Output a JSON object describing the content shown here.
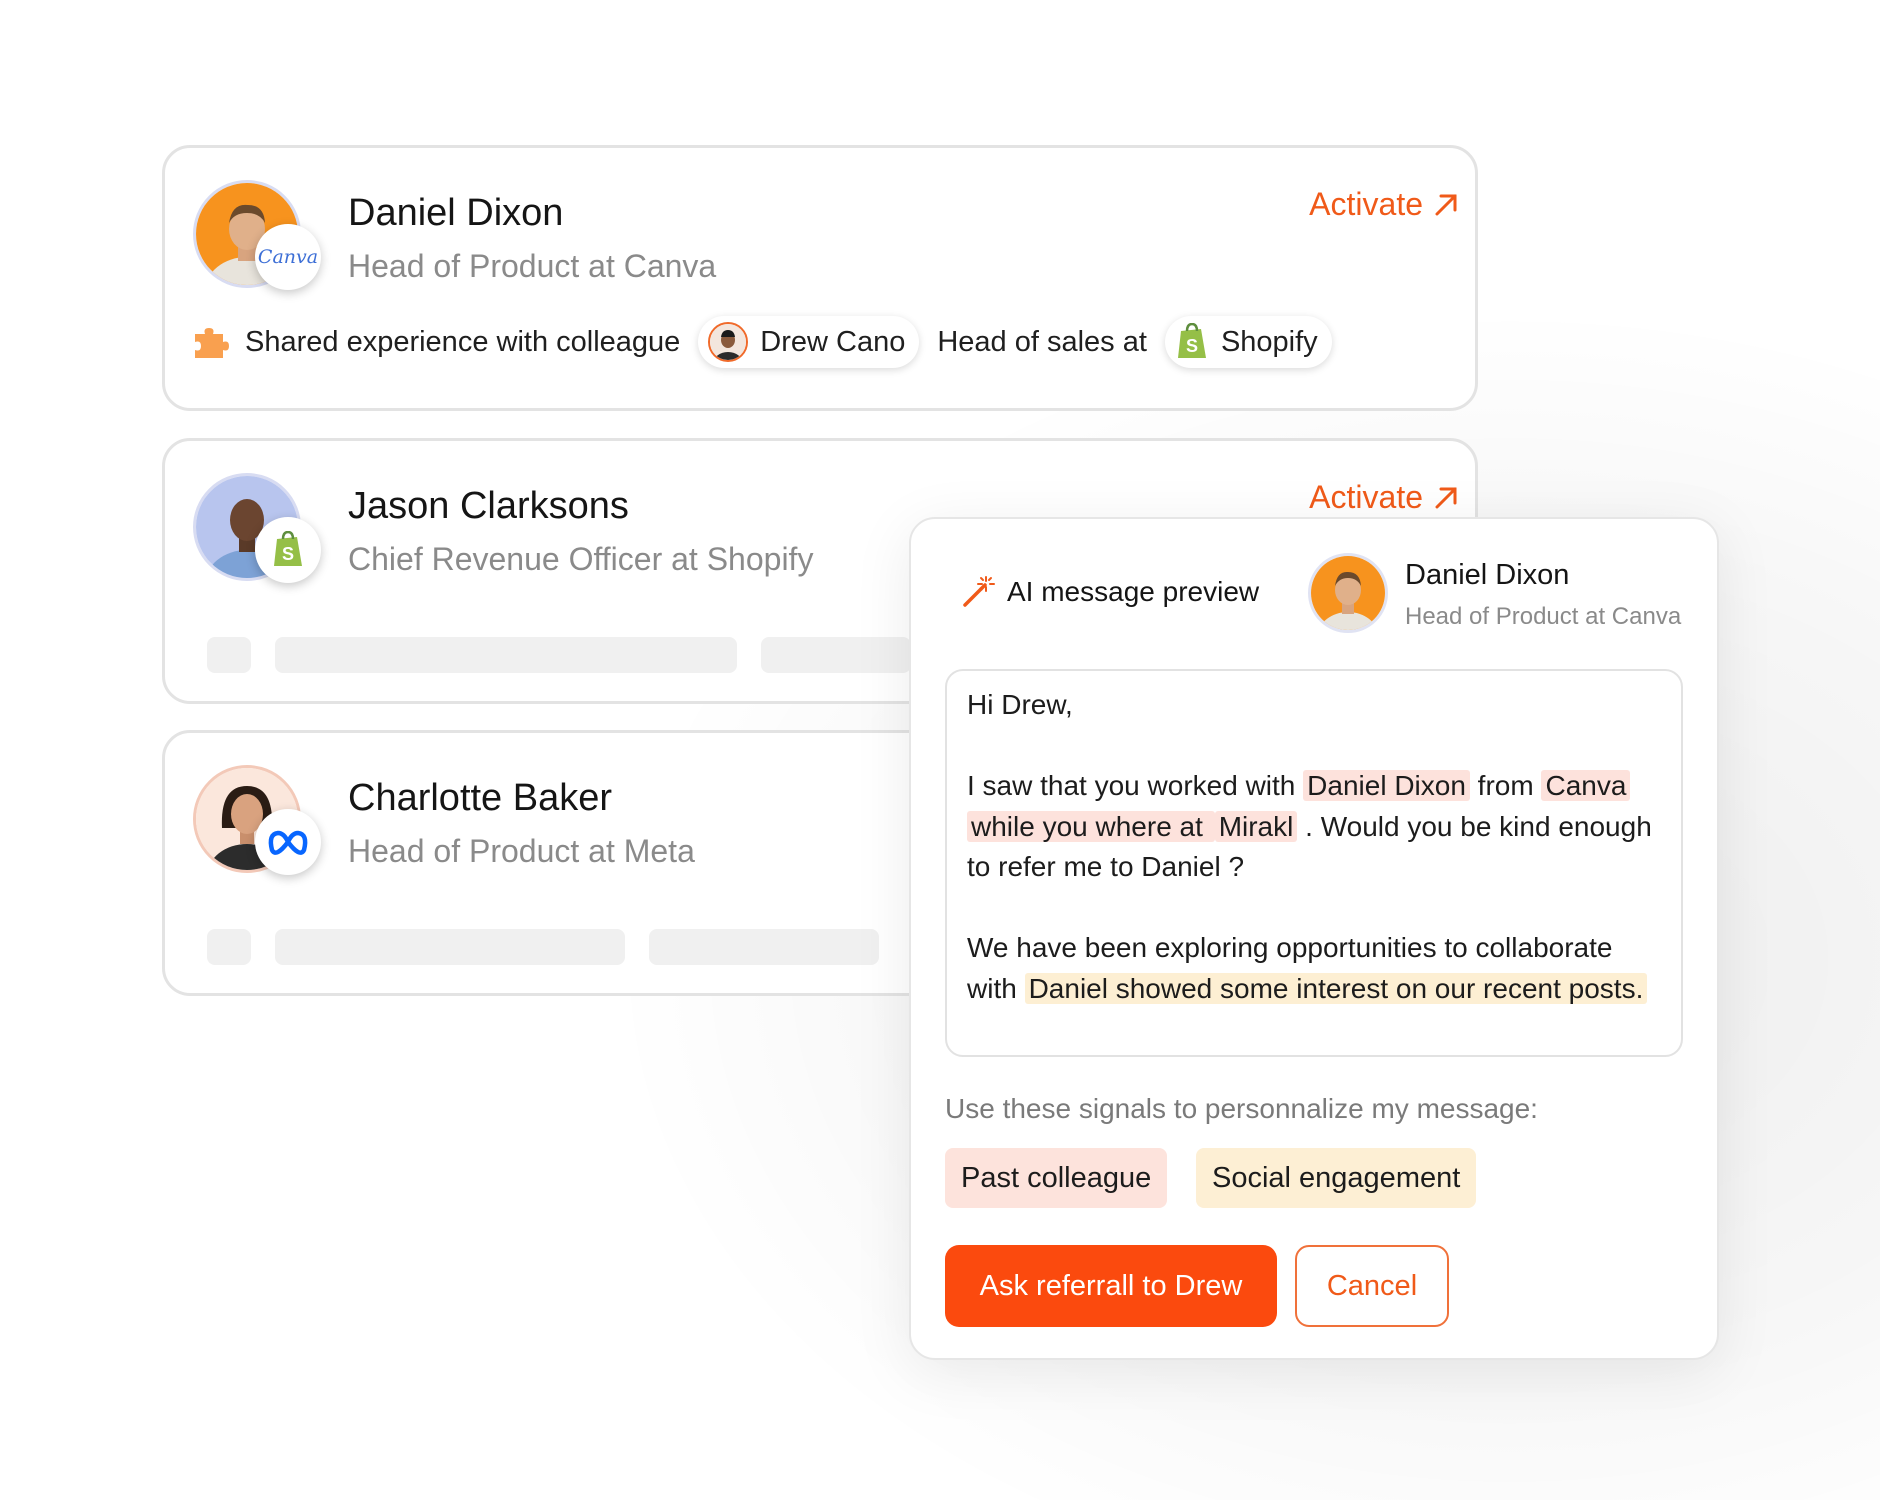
{
  "contacts": [
    {
      "name": "Daniel Dixon",
      "title": "Head of Product at Canva",
      "company_badge": "Canva",
      "activate_label": "Activate",
      "signal": {
        "icon": "puzzle-icon",
        "text": "Shared experience with colleague",
        "colleague_name": "Drew Cano",
        "connector": "Head of sales at",
        "company": "Shopify"
      }
    },
    {
      "name": "Jason Clarksons",
      "title": "Chief Revenue Officer at Shopify",
      "company_badge": "shopify-logo-icon",
      "activate_label": "Activate"
    },
    {
      "name": "Charlotte Baker",
      "title": "Head of Product at Meta",
      "company_badge": "meta-logo-icon"
    }
  ],
  "preview": {
    "label": "AI message preview",
    "contact_name": "Daniel Dixon",
    "contact_title": "Head of Product at Canva",
    "message": {
      "greeting": "Hi Drew,",
      "p1_a": "I saw that you worked with ",
      "p1_hl1": "Daniel Dixon",
      "p1_b": " from ",
      "p1_hl2": "Canva",
      "p1_hl3": "while you where at ",
      "p1_hl4": "Mirakl",
      "p1_c": " . Would you be kind enough to refer me to Daniel ?",
      "p2_a": "We have been exploring opportunities to collaborate with ",
      "p2_hl": "Daniel showed some interest on our recent posts."
    },
    "signals_label": "Use these signals to personnalize my message:",
    "signals": [
      "Past colleague",
      "Social engagement"
    ],
    "primary_button": "Ask referrall to Drew",
    "cancel_button": "Cancel"
  },
  "colors": {
    "accent": "#fb4a0e",
    "activate": "#f05a19",
    "highlight_red": "#fde2dc",
    "highlight_yellow": "#fdefd3"
  }
}
